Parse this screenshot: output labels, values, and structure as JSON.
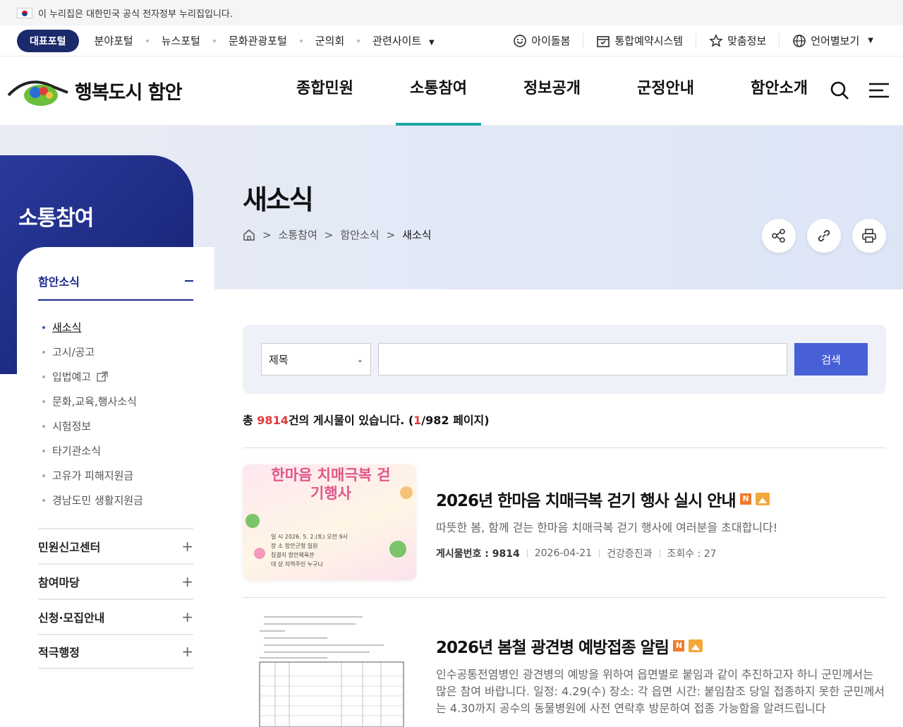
{
  "gov_banner": "이 누리집은 대한민국 공식 전자정부 누리집입니다.",
  "util": {
    "main": "대표포털",
    "links": [
      "분야포털",
      "뉴스포털",
      "문화관광포털",
      "군의회",
      "관련사이트"
    ],
    "right": [
      "아이돌봄",
      "통합예약시스템",
      "맞춤정보",
      "언어별보기"
    ]
  },
  "logo": {
    "text": "행복도시 함안"
  },
  "gnb": [
    "종합민원",
    "소통참여",
    "정보공개",
    "군정안내",
    "함안소개"
  ],
  "side": {
    "title": "소통참여",
    "group": "함안소식",
    "items": [
      "새소식",
      "고시/공고",
      "입법예고",
      "문화,교육,행사소식",
      "시험정보",
      "타기관소식",
      "고유가 피해지원금",
      "경남도민 생활지원금"
    ],
    "cats": [
      "민원신고센터",
      "참여마당",
      "신청·모집안내",
      "적극행정"
    ]
  },
  "page": {
    "title": "새소식",
    "crumbs": [
      "소통참여",
      "함안소식",
      "새소식"
    ]
  },
  "search": {
    "select": "제목",
    "button": "검색"
  },
  "count": {
    "pre": "총 ",
    "num": "9814",
    "mid": "건의 게시물이 있습니다. (",
    "page": "1",
    "post": "/982 페이지)"
  },
  "posts": [
    {
      "title": "2026년 한마음 치매극복 걷기 행사 실시 안내",
      "desc": "따뜻한 봄, 함께 걷는 한마음 치매극복 걷기 행사에 여러분을 초대합니다!",
      "no_label": "게시물번호 : ",
      "no": "9814",
      "date": "2026-04-21",
      "dept": "건강증진과",
      "views": "조회수 : 27",
      "thumb_title": "한마음 치매극복 걷기행사",
      "thumb_lines": [
        "일 시  2026. 5. 2.(토) 오전 9시",
        "장 소  함안군청 일원",
        "집결지  함안체육관",
        "대 상  지역주민 누구나"
      ]
    },
    {
      "title": "2026년 봄철 광견병 예방접종 알림",
      "desc": "인수공통전염병인 광견병의 예방을 위하여 읍면별로 붙임과 같이 추진하고자 하니 군민께서는 많은 참여 바랍니다. 일정: 4.29(수) 장소: 각 읍면 시간: 붙임참조 당일 접종하지 못한 군민께서는 4.30까지 공수의 동물병원에 사전 연락후 방문하여 접종 가능함을 알려드립니다"
    }
  ],
  "badge_n": "N"
}
